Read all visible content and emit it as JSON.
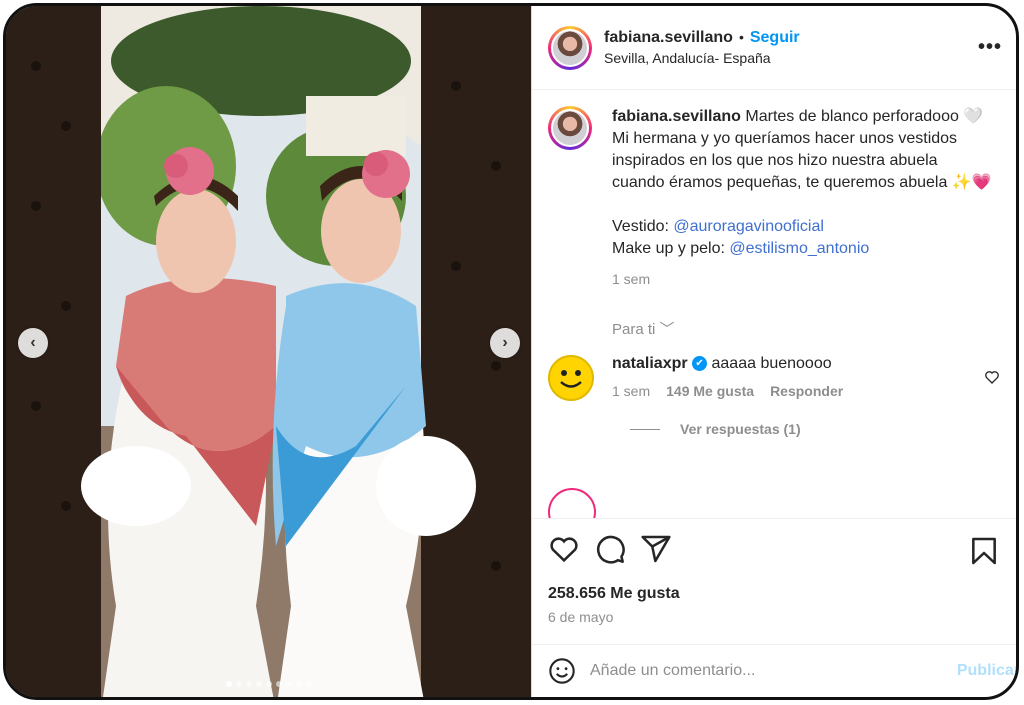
{
  "post": {
    "username": "fabiana.sevillano",
    "separator": "•",
    "follow_label": "Seguir",
    "location": "Sevilla, Andalucía- España",
    "more_label": "•••"
  },
  "caption": {
    "username": "fabiana.sevillano",
    "text_1": "Martes de blanco perforadooo 🤍 Mi hermana y yo queríamos hacer unos vestidos inspirados en los que nos hizo nuestra abuela cuando éramos pequeñas, te queremos abuela ✨💗",
    "vestido_label": "Vestido:",
    "vestido_mention": "@auroragavinooficial",
    "makeup_label": "Make up y pelo:",
    "makeup_mention": "@estilismo_antonio",
    "time": "1 sem"
  },
  "para_ti": "Para ti ﹀",
  "comment": {
    "username": "nataliaxpr",
    "verified_icon": "✔",
    "text": "aaaaa buenoooo",
    "time": "1 sem",
    "likes": "149 Me gusta",
    "reply_label": "Responder",
    "view_replies": "Ver respuestas (1)"
  },
  "likes_count": "258.656 Me gusta",
  "post_date": "6 de mayo",
  "add_comment": {
    "placeholder": "Añade un comentario...",
    "publish_label": "Publicar"
  },
  "carousel": {
    "prev_label": "‹",
    "next_label": "›",
    "dot_count": 9,
    "active_dot": 0
  },
  "colors": {
    "accent": "#0095f6",
    "text": "#262626",
    "muted": "#8e8e8e",
    "mention": "#3f6fd1"
  }
}
